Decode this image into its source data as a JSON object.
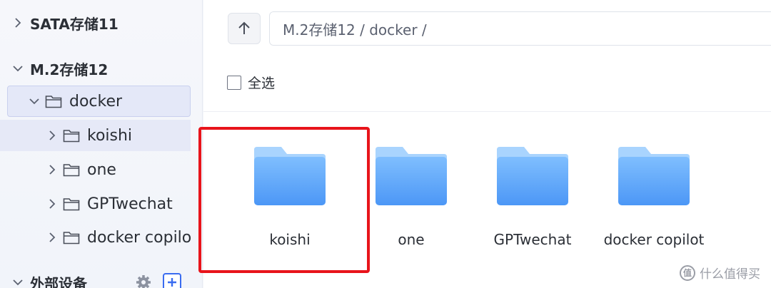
{
  "sidebar": {
    "items": [
      {
        "label": "SATA存储11",
        "expanded": false,
        "type": "drive"
      },
      {
        "label": "M.2存储12",
        "expanded": true,
        "type": "drive"
      },
      {
        "label": "docker",
        "expanded": true,
        "type": "folder",
        "selected": true
      },
      {
        "label": "koishi",
        "expanded": false,
        "type": "folder",
        "hovered": true
      },
      {
        "label": "one",
        "expanded": false,
        "type": "folder"
      },
      {
        "label": "GPTwechat",
        "expanded": false,
        "type": "folder"
      },
      {
        "label": "docker copilot",
        "expanded": false,
        "type": "folder"
      },
      {
        "label": "外部设备",
        "expanded": true,
        "type": "section"
      }
    ],
    "section_icons": [
      "gear-icon",
      "add-icon"
    ]
  },
  "toolbar": {
    "up_icon": "arrow-up-icon",
    "path": "M.2存储12 / docker /"
  },
  "select_all": {
    "label": "全选",
    "checked": false
  },
  "files": [
    {
      "name": "koishi",
      "icon": "folder-icon",
      "highlighted": true
    },
    {
      "name": "one",
      "icon": "folder-icon"
    },
    {
      "name": "GPTwechat",
      "icon": "folder-icon"
    },
    {
      "name": "docker copilot",
      "icon": "folder-icon"
    }
  ],
  "watermark": {
    "text": "什么值得买",
    "logo": "值"
  },
  "colors": {
    "accent": "#3a6cf0",
    "highlight_box": "#e8141b",
    "folder_light": "#8fc6fd",
    "folder_dark": "#4f9af7"
  }
}
